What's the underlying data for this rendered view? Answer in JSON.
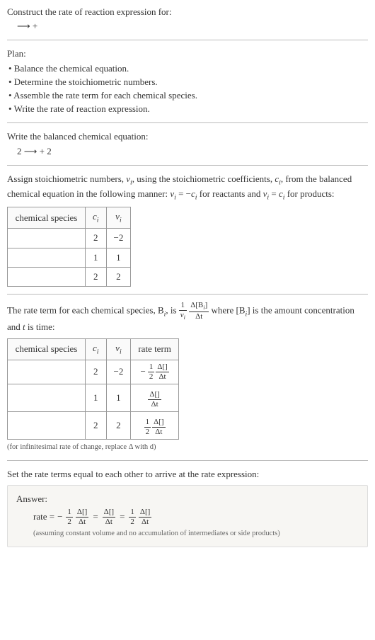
{
  "intro": {
    "prompt": "Construct the rate of reaction expression for:",
    "equation": "⟶  +"
  },
  "plan": {
    "heading": "Plan:",
    "bullets": [
      "• Balance the chemical equation.",
      "• Determine the stoichiometric numbers.",
      "• Assemble the rate term for each chemical species.",
      "• Write the rate of reaction expression."
    ]
  },
  "balanced": {
    "heading": "Write the balanced chemical equation:",
    "equation": "2  ⟶  + 2"
  },
  "stoich": {
    "text_parts": {
      "a": "Assign stoichiometric numbers, ",
      "nu_i": "ν",
      "b": ", using the stoichiometric coefficients, ",
      "c_i": "c",
      "c": ", from the balanced chemical equation in the following manner: ",
      "rel1_lhs": "ν",
      "rel1_eq": " = −",
      "rel1_rhs": "c",
      "d": " for reactants and ",
      "rel2_lhs": "ν",
      "rel2_eq": " = ",
      "rel2_rhs": "c",
      "e": " for products:"
    },
    "headers": {
      "species": "chemical species",
      "c": "c",
      "nu": "ν"
    },
    "rows": [
      {
        "species": "",
        "c": "2",
        "nu": "−2"
      },
      {
        "species": "",
        "c": "1",
        "nu": "1"
      },
      {
        "species": "",
        "c": "2",
        "nu": "2"
      }
    ]
  },
  "rate_term": {
    "text_parts": {
      "a": "The rate term for each chemical species, B",
      "b": ", is ",
      "frac1_num": "1",
      "frac1_den_sym": "ν",
      "frac2_num": "Δ[B",
      "frac2_num_close": "]",
      "frac2_den": "Δt",
      "c": " where [B",
      "d": "] is the amount concentration and ",
      "t": "t",
      "e": " is time:"
    },
    "headers": {
      "species": "chemical species",
      "c": "c",
      "nu": "ν",
      "rate": "rate term"
    },
    "rows": [
      {
        "species": "",
        "c": "2",
        "nu": "−2",
        "sign": "−",
        "coef_num": "1",
        "coef_den": "2",
        "num": "Δ[]",
        "den": "Δt"
      },
      {
        "species": "",
        "c": "1",
        "nu": "1",
        "sign": "",
        "coef_num": "",
        "coef_den": "",
        "num": "Δ[]",
        "den": "Δt"
      },
      {
        "species": "",
        "c": "2",
        "nu": "2",
        "sign": "",
        "coef_num": "1",
        "coef_den": "2",
        "num": "Δ[]",
        "den": "Δt"
      }
    ],
    "note": "(for infinitesimal rate of change, replace Δ with d)"
  },
  "final": {
    "heading": "Set the rate terms equal to each other to arrive at the rate expression:",
    "answer_label": "Answer:",
    "rate_label": "rate = ",
    "terms": [
      {
        "sign": "−",
        "coef_num": "1",
        "coef_den": "2",
        "num": "Δ[]",
        "den": "Δt"
      },
      {
        "sign": "",
        "coef_num": "",
        "coef_den": "",
        "num": "Δ[]",
        "den": "Δt"
      },
      {
        "sign": "",
        "coef_num": "1",
        "coef_den": "2",
        "num": "Δ[]",
        "den": "Δt"
      }
    ],
    "assumption": "(assuming constant volume and no accumulation of intermediates or side products)"
  },
  "sub_i": "i"
}
